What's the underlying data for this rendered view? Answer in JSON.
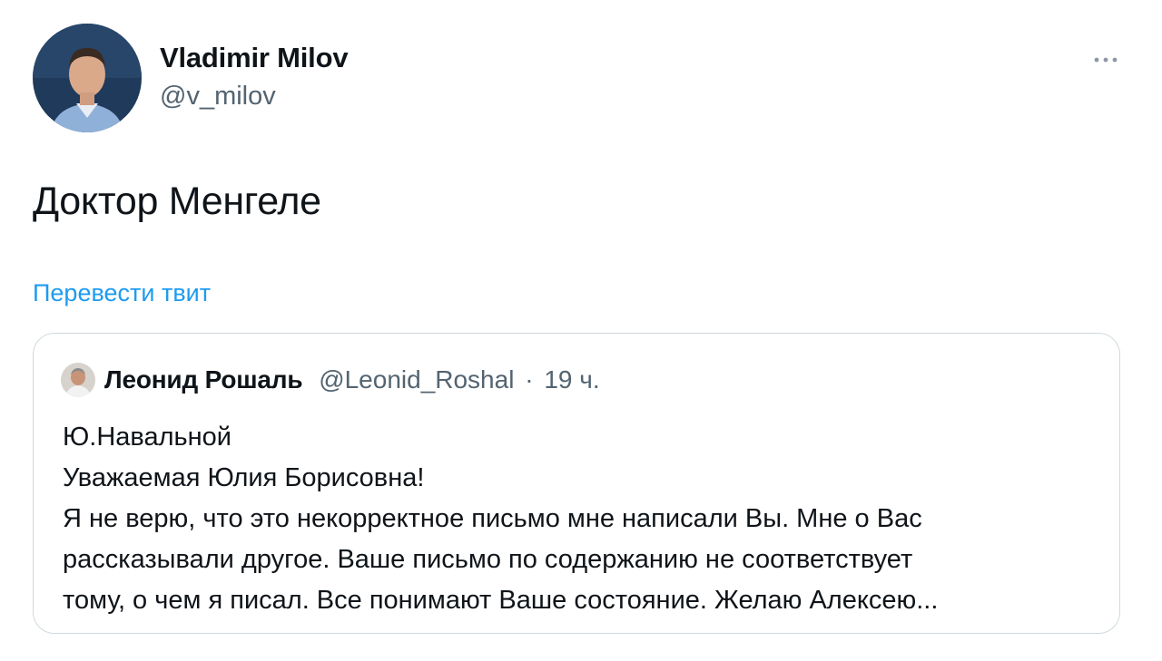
{
  "tweet": {
    "author": {
      "name": "Vladimir Milov",
      "handle": "@v_milov"
    },
    "text": "Доктор Менгеле",
    "translate_label": "Перевести твит",
    "more_icon": "more-dots-icon"
  },
  "quoted_tweet": {
    "author": {
      "name": "Леонид Рошаль",
      "handle": "@Leonid_Roshal"
    },
    "separator": "·",
    "time": "19 ч.",
    "lines": [
      "Ю.Навальной",
      "Уважаемая Юлия Борисовна!",
      "Я не верю, что это некорректное письмо мне написали Вы. Мне о Вас",
      "рассказывали другое. Ваше письмо по содержанию не соответствует",
      "тому, о чем я писал. Все понимают Ваше состояние. Желаю Алексею..."
    ]
  },
  "colors": {
    "link": "#1d9bf0",
    "secondary_text": "#536471",
    "border": "#cfd9de"
  }
}
